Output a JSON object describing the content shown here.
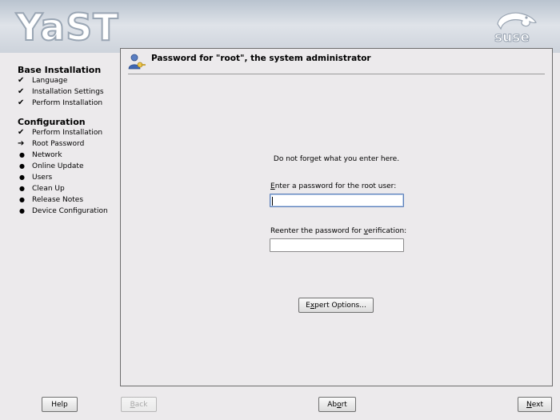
{
  "header": {
    "app_logo": "YaST",
    "brand_logo": "suse"
  },
  "sidebar": {
    "sections": [
      {
        "title": "Base Installation",
        "steps": [
          {
            "label": "Language",
            "status": "done"
          },
          {
            "label": "Installation Settings",
            "status": "done"
          },
          {
            "label": "Perform Installation",
            "status": "done"
          }
        ]
      },
      {
        "title": "Configuration",
        "steps": [
          {
            "label": "Perform Installation",
            "status": "done"
          },
          {
            "label": "Root Password",
            "status": "current"
          },
          {
            "label": "Network",
            "status": "pending"
          },
          {
            "label": "Online Update",
            "status": "pending"
          },
          {
            "label": "Users",
            "status": "pending"
          },
          {
            "label": "Clean Up",
            "status": "pending"
          },
          {
            "label": "Release Notes",
            "status": "pending"
          },
          {
            "label": "Device Configuration",
            "status": "pending"
          }
        ]
      }
    ]
  },
  "dialog": {
    "title": "Password for \"root\", the system administrator",
    "icon": "user-key-icon",
    "hint": "Do not forget what you enter here.",
    "password_label_pre": "",
    "password_label_key": "E",
    "password_label_post": "nter a password for the root user:",
    "password_value": "",
    "verify_label_pre": "Reenter the password for ",
    "verify_label_key": "v",
    "verify_label_post": "erification:",
    "verify_value": "",
    "expert_pre": "E",
    "expert_key": "x",
    "expert_post": "pert Options..."
  },
  "footer": {
    "help": "Help",
    "back_pre": "",
    "back_key": "B",
    "back_post": "ack",
    "abort_pre": "Ab",
    "abort_key": "o",
    "abort_post": "rt",
    "next_pre": "",
    "next_key": "N",
    "next_post": "ext"
  },
  "colors": {
    "accent": "#5b7fb9",
    "panel_bg": "#eceaec",
    "header_top": "#b9c3cf"
  }
}
